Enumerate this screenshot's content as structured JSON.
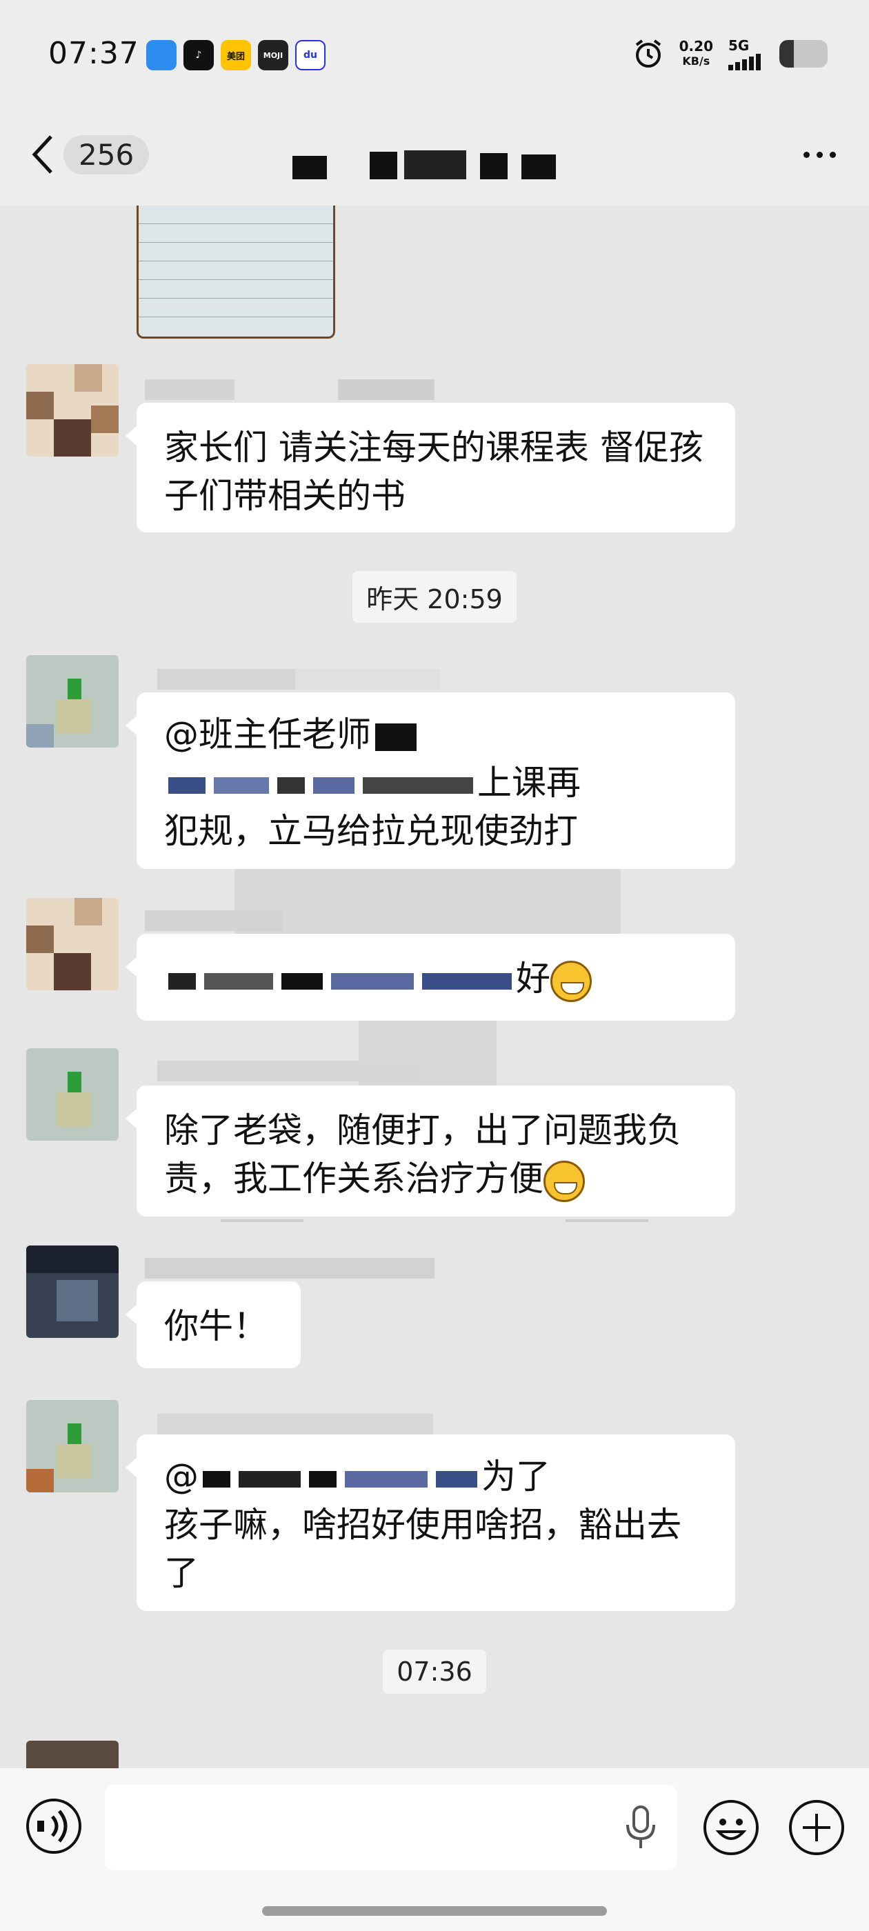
{
  "status_bar": {
    "time": "07:37",
    "apps": [
      {
        "icon": "browser-icon",
        "color": "#2d8cf0",
        "label": ""
      },
      {
        "icon": "tiktok-icon",
        "color": "#111111",
        "label": "♪"
      },
      {
        "icon": "meituan-icon",
        "color": "#ffc300",
        "label": "美团"
      },
      {
        "icon": "moji-weather-icon",
        "color": "#222222",
        "label": "MOJI"
      },
      {
        "icon": "baidu-icon",
        "color": "#2932e1",
        "label": "du"
      }
    ],
    "net_speed_value": "0.20",
    "net_speed_unit": "KB/s",
    "network": "5G",
    "battery_level": 0.3
  },
  "header": {
    "unread_count": "256",
    "title": ""
  },
  "messages": [
    {
      "type": "text",
      "text": "家长们 请关注每天的课程表 督促孩子们带相关的书"
    },
    {
      "type": "timestamp",
      "text": "昨天 20:59"
    },
    {
      "type": "text",
      "line1": "@班主任老师",
      "line3": "上课再",
      "line4": "犯规，立马给拉兑现使劲打"
    },
    {
      "type": "text",
      "text": "好"
    },
    {
      "type": "text",
      "text": "除了老袋，随便打，出了问题我负责，我工作关系治疗方便"
    },
    {
      "type": "text",
      "text": "你牛！"
    },
    {
      "type": "text",
      "line1a": "@",
      "line1b": "为了",
      "line2": "孩子嘛，啥招好使用啥招，豁出去了"
    },
    {
      "type": "timestamp",
      "text": "07:36"
    }
  ],
  "colors": {
    "background": "#ededed",
    "bubble": "#ffffff",
    "emoji_yellow": "#f7c32e"
  }
}
